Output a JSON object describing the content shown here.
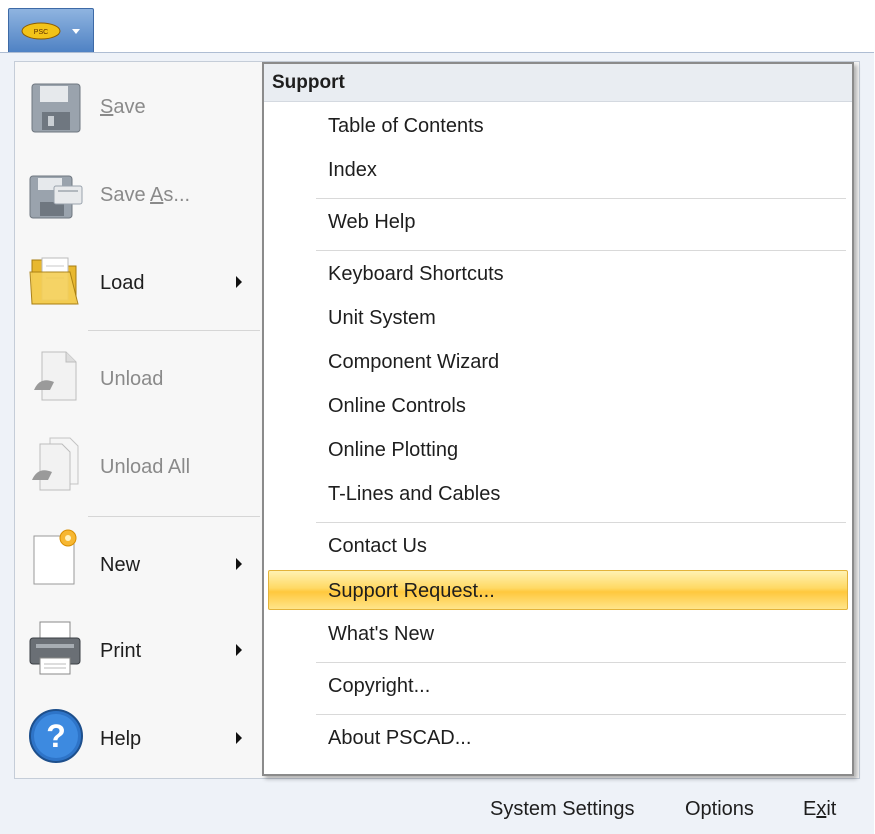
{
  "app_button": {
    "logo_text": "PSC"
  },
  "left_menu": {
    "items": [
      {
        "label": "Save",
        "mnemonic": "S",
        "rest": "ave",
        "disabled": true,
        "has_submenu": false,
        "icon": "floppy-disk-icon"
      },
      {
        "label": "Save As...",
        "pre": "Save ",
        "mnemonic": "A",
        "rest": "s...",
        "disabled": true,
        "has_submenu": false,
        "icon": "floppy-disks-icon"
      },
      {
        "label": "Load",
        "disabled": false,
        "has_submenu": true,
        "icon": "folder-icon"
      },
      {
        "label": "Unload",
        "disabled": true,
        "has_submenu": false,
        "icon": "document-unload-icon"
      },
      {
        "label": "Unload All",
        "disabled": true,
        "has_submenu": false,
        "icon": "documents-unload-icon"
      },
      {
        "label": "New",
        "disabled": false,
        "has_submenu": true,
        "icon": "new-document-icon"
      },
      {
        "label": "Print",
        "disabled": false,
        "has_submenu": true,
        "icon": "printer-icon"
      },
      {
        "label": "Help",
        "disabled": false,
        "has_submenu": true,
        "icon": "help-icon"
      }
    ]
  },
  "submenu": {
    "header": "Support",
    "items": [
      {
        "label": "Table of Contents"
      },
      {
        "label": "Index"
      },
      {
        "label": "Web Help"
      },
      {
        "label": "Keyboard Shortcuts"
      },
      {
        "label": "Unit System"
      },
      {
        "label": "Component Wizard"
      },
      {
        "label": "Online Controls"
      },
      {
        "label": "Online Plotting"
      },
      {
        "label": "T-Lines and Cables"
      },
      {
        "label": "Contact Us"
      },
      {
        "label": "Support Request...",
        "highlighted": true
      },
      {
        "label": "What's New"
      },
      {
        "label": "Copyright..."
      },
      {
        "label": "About PSCAD..."
      }
    ]
  },
  "bottom_bar": {
    "system_settings": "System Settings",
    "options": "Options",
    "exit_pre": "E",
    "exit_mnemonic": "x",
    "exit_post": "it"
  },
  "colors": {
    "highlight": "#ffd964",
    "menu_background": "#f7f7f7",
    "frame_background": "#eef2f8",
    "app_button": "#4f82c4"
  }
}
